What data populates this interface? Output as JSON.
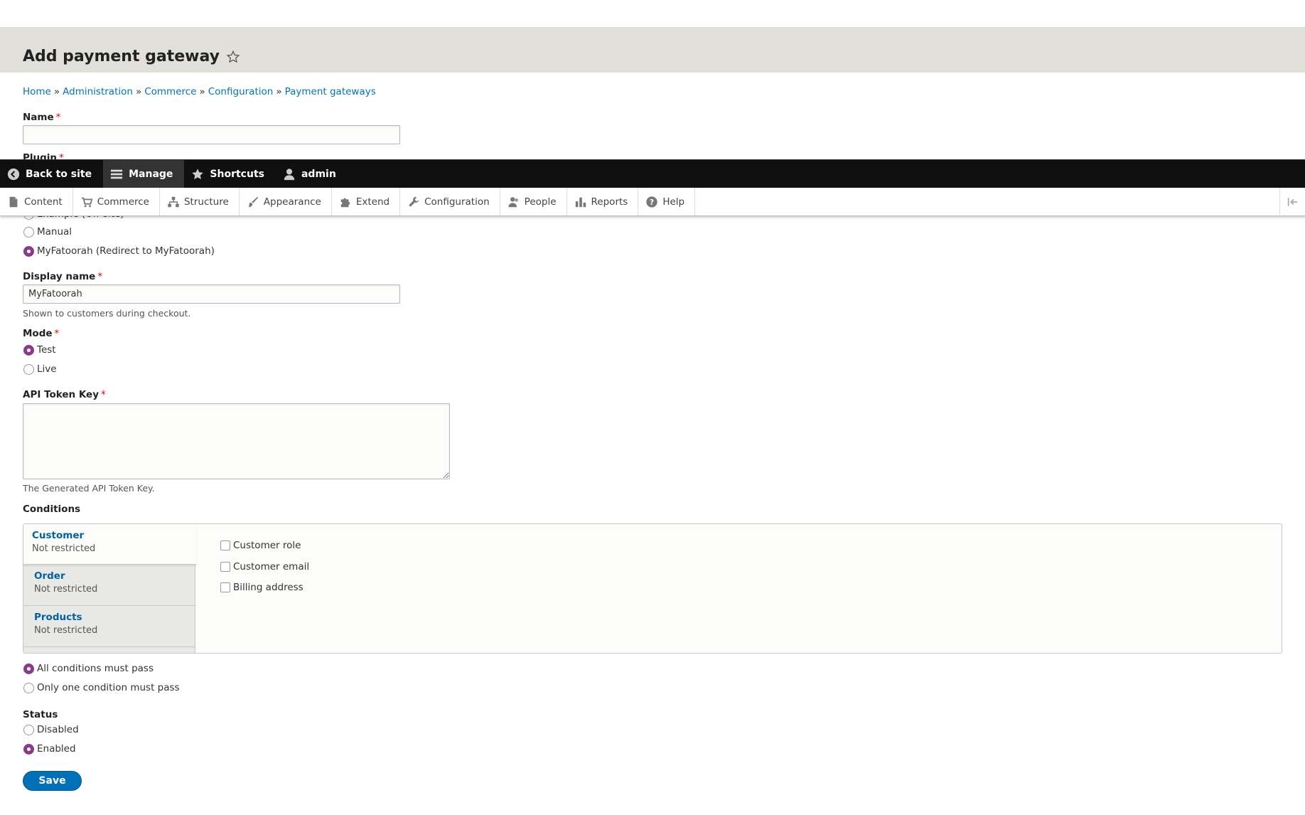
{
  "page": {
    "title": "Add payment gateway"
  },
  "breadcrumb": [
    "Home",
    "Administration",
    "Commerce",
    "Configuration",
    "Payment gateways"
  ],
  "breadcrumb_separator": "»",
  "form": {
    "name_label": "Name",
    "name_value": "",
    "plugin_label": "Plugin",
    "plugin_options": [
      {
        "label": "Example (Off-site)",
        "selected": false
      },
      {
        "label": "Manual",
        "selected": false
      },
      {
        "label": "MyFatoorah (Redirect to MyFatoorah)",
        "selected": true
      }
    ],
    "display_name_label": "Display name",
    "display_name_value": "MyFatoorah",
    "display_name_desc": "Shown to customers during checkout.",
    "mode_label": "Mode",
    "mode_options": [
      {
        "label": "Test",
        "selected": true
      },
      {
        "label": "Live",
        "selected": false
      }
    ],
    "api_label": "API Token Key",
    "api_value": "",
    "api_desc": "The Generated API Token Key.",
    "conditions_label": "Conditions",
    "condition_tabs": [
      {
        "title": "Customer",
        "summary": "Not restricted",
        "selected": true
      },
      {
        "title": "Order",
        "summary": "Not restricted",
        "selected": false
      },
      {
        "title": "Products",
        "summary": "Not restricted",
        "selected": false
      }
    ],
    "customer_checks": [
      "Customer role",
      "Customer email",
      "Billing address"
    ],
    "condition_operator": [
      {
        "label": "All conditions must pass",
        "selected": true
      },
      {
        "label": "Only one condition must pass",
        "selected": false
      }
    ],
    "status_label": "Status",
    "status_options": [
      {
        "label": "Disabled",
        "selected": false
      },
      {
        "label": "Enabled",
        "selected": true
      }
    ],
    "save_label": "Save"
  },
  "toolbar": {
    "back": "Back to site",
    "manage": "Manage",
    "shortcuts": "Shortcuts",
    "user": "admin"
  },
  "tray": [
    "Content",
    "Commerce",
    "Structure",
    "Appearance",
    "Extend",
    "Configuration",
    "People",
    "Reports",
    "Help"
  ],
  "colors": {
    "link": "#0074bd",
    "radio_checked": "#8a3a8a",
    "save_button": "#0071b8",
    "toolbar_bg": "#0f0f0f",
    "header_band": "#e1e0da"
  },
  "icons": {
    "back": "chevron-left-circle-icon",
    "manage": "hamburger-menu-icon",
    "shortcuts": "star-icon",
    "user": "user-icon",
    "tray": [
      "document-icon",
      "cart-icon",
      "sitemap-icon",
      "paintbrush-icon",
      "puzzle-icon",
      "wrench-icon",
      "person-icon",
      "bar-chart-icon",
      "help-icon"
    ],
    "title_star": "star-outline-icon"
  }
}
